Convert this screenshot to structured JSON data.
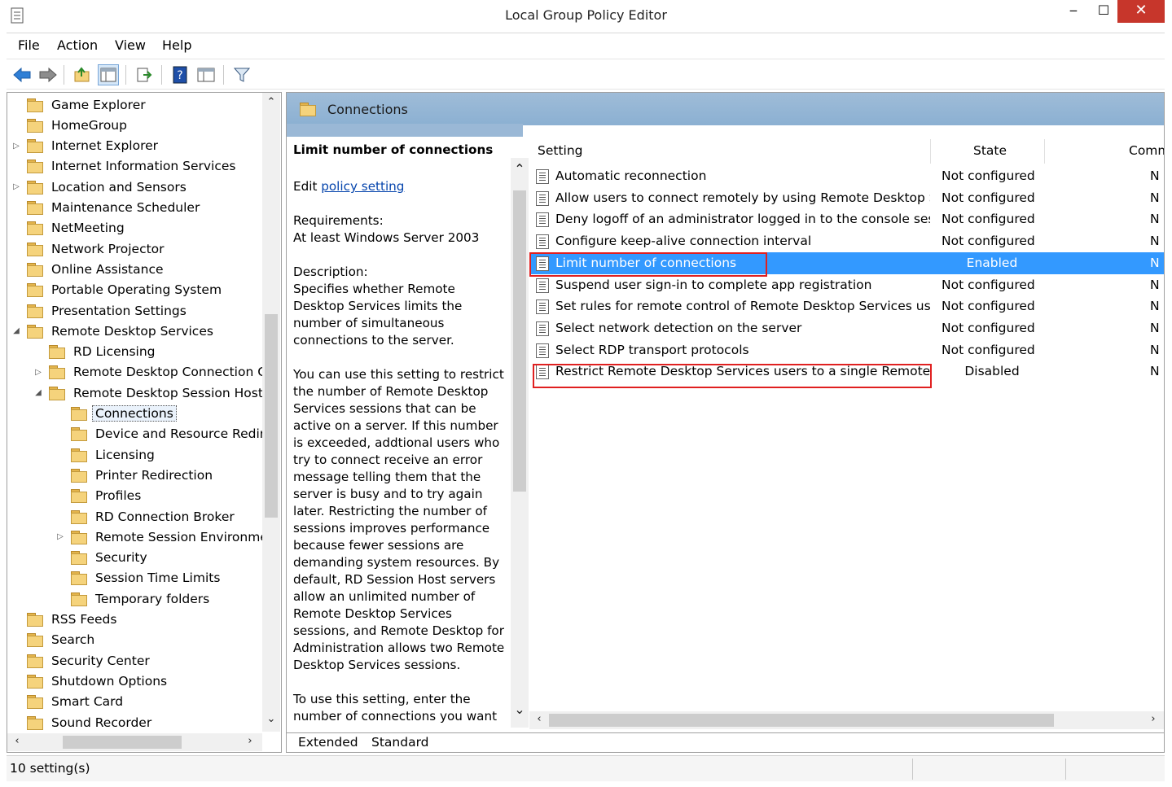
{
  "window": {
    "title": "Local Group Policy Editor",
    "minimize": "‒",
    "maximize": "☐",
    "close": "✕"
  },
  "menu": [
    "File",
    "Action",
    "View",
    "Help"
  ],
  "tree": {
    "items": [
      {
        "label": "Game Explorer",
        "indent": 0,
        "arrow": ""
      },
      {
        "label": "HomeGroup",
        "indent": 0,
        "arrow": ""
      },
      {
        "label": "Internet Explorer",
        "indent": 0,
        "arrow": "▷"
      },
      {
        "label": "Internet Information Services",
        "indent": 0,
        "arrow": ""
      },
      {
        "label": "Location and Sensors",
        "indent": 0,
        "arrow": "▷"
      },
      {
        "label": "Maintenance Scheduler",
        "indent": 0,
        "arrow": ""
      },
      {
        "label": "NetMeeting",
        "indent": 0,
        "arrow": ""
      },
      {
        "label": "Network Projector",
        "indent": 0,
        "arrow": ""
      },
      {
        "label": "Online Assistance",
        "indent": 0,
        "arrow": ""
      },
      {
        "label": "Portable Operating System",
        "indent": 0,
        "arrow": ""
      },
      {
        "label": "Presentation Settings",
        "indent": 0,
        "arrow": ""
      },
      {
        "label": "Remote Desktop Services",
        "indent": 0,
        "arrow": "◢"
      },
      {
        "label": "RD Licensing",
        "indent": 1,
        "arrow": ""
      },
      {
        "label": "Remote Desktop Connection C",
        "indent": 1,
        "arrow": "▷"
      },
      {
        "label": "Remote Desktop Session Host",
        "indent": 1,
        "arrow": "◢"
      },
      {
        "label": "Connections",
        "indent": 2,
        "arrow": "",
        "selected": true
      },
      {
        "label": "Device and Resource Redire",
        "indent": 2,
        "arrow": ""
      },
      {
        "label": "Licensing",
        "indent": 2,
        "arrow": ""
      },
      {
        "label": "Printer Redirection",
        "indent": 2,
        "arrow": ""
      },
      {
        "label": "Profiles",
        "indent": 2,
        "arrow": ""
      },
      {
        "label": "RD Connection Broker",
        "indent": 2,
        "arrow": ""
      },
      {
        "label": "Remote Session Environme",
        "indent": 2,
        "arrow": "▷"
      },
      {
        "label": "Security",
        "indent": 2,
        "arrow": ""
      },
      {
        "label": "Session Time Limits",
        "indent": 2,
        "arrow": ""
      },
      {
        "label": "Temporary folders",
        "indent": 2,
        "arrow": ""
      },
      {
        "label": "RSS Feeds",
        "indent": 0,
        "arrow": ""
      },
      {
        "label": "Search",
        "indent": 0,
        "arrow": ""
      },
      {
        "label": "Security Center",
        "indent": 0,
        "arrow": ""
      },
      {
        "label": "Shutdown Options",
        "indent": 0,
        "arrow": ""
      },
      {
        "label": "Smart Card",
        "indent": 0,
        "arrow": ""
      },
      {
        "label": "Sound Recorder",
        "indent": 0,
        "arrow": ""
      }
    ]
  },
  "header": {
    "title": "Connections"
  },
  "description": {
    "heading": "Limit number of connections",
    "edit_prefix": "Edit ",
    "edit_link": "policy setting",
    "req_label": "Requirements:",
    "req_value": "At least Windows Server 2003",
    "desc_label": "Description:",
    "desc_p1": "Specifies whether Remote Desktop Services limits the number of simultaneous connections to the server.",
    "desc_p2": "You can use this setting to restrict the number of Remote Desktop Services sessions that can be active on a server. If this number is exceeded, addtional users who try to connect receive an error message telling them that the server is busy and to try again later. Restricting the number of sessions improves performance because fewer sessions are demanding system resources. By default, RD Session Host servers allow an unlimited number of Remote Desktop Services sessions, and Remote Desktop for Administration allows two Remote Desktop Services sessions.",
    "desc_p3": "To use this setting, enter the number of connections you want"
  },
  "columns": {
    "setting": "Setting",
    "state": "State",
    "comment": "Comm"
  },
  "settings": [
    {
      "name": "Automatic reconnection",
      "state": "Not configured",
      "comment": "N"
    },
    {
      "name": "Allow users to connect remotely by using Remote Desktop S...",
      "state": "Not configured",
      "comment": "N"
    },
    {
      "name": "Deny logoff of an administrator logged in to the console ses...",
      "state": "Not configured",
      "comment": "N"
    },
    {
      "name": "Configure keep-alive connection interval",
      "state": "Not configured",
      "comment": "N"
    },
    {
      "name": "Limit number of connections",
      "state": "Enabled",
      "comment": "N",
      "selected": true
    },
    {
      "name": "Suspend user sign-in to complete app registration",
      "state": "Not configured",
      "comment": "N"
    },
    {
      "name": "Set rules for remote control of Remote Desktop Services use...",
      "state": "Not configured",
      "comment": "N"
    },
    {
      "name": "Select network detection on the server",
      "state": "Not configured",
      "comment": "N"
    },
    {
      "name": "Select RDP transport protocols",
      "state": "Not configured",
      "comment": "N"
    },
    {
      "name": "Restrict Remote Desktop Services users to a single Remote D...",
      "state": "Disabled",
      "comment": "N"
    }
  ],
  "tabs": {
    "extended": "Extended",
    "standard": "Standard"
  },
  "status": {
    "text": "10 setting(s)"
  },
  "colors": {
    "selection": "#3399ff",
    "highlight_box": "#e02020",
    "header_band": "#9ab8d6",
    "close_button": "#c7362b"
  },
  "icons": [
    "app-icon",
    "back-icon",
    "forward-icon",
    "up-folder-icon",
    "show-hide-tree-icon",
    "export-list-icon",
    "help-icon",
    "properties-icon",
    "filter-icon",
    "folder-icon",
    "policy-setting-icon"
  ]
}
